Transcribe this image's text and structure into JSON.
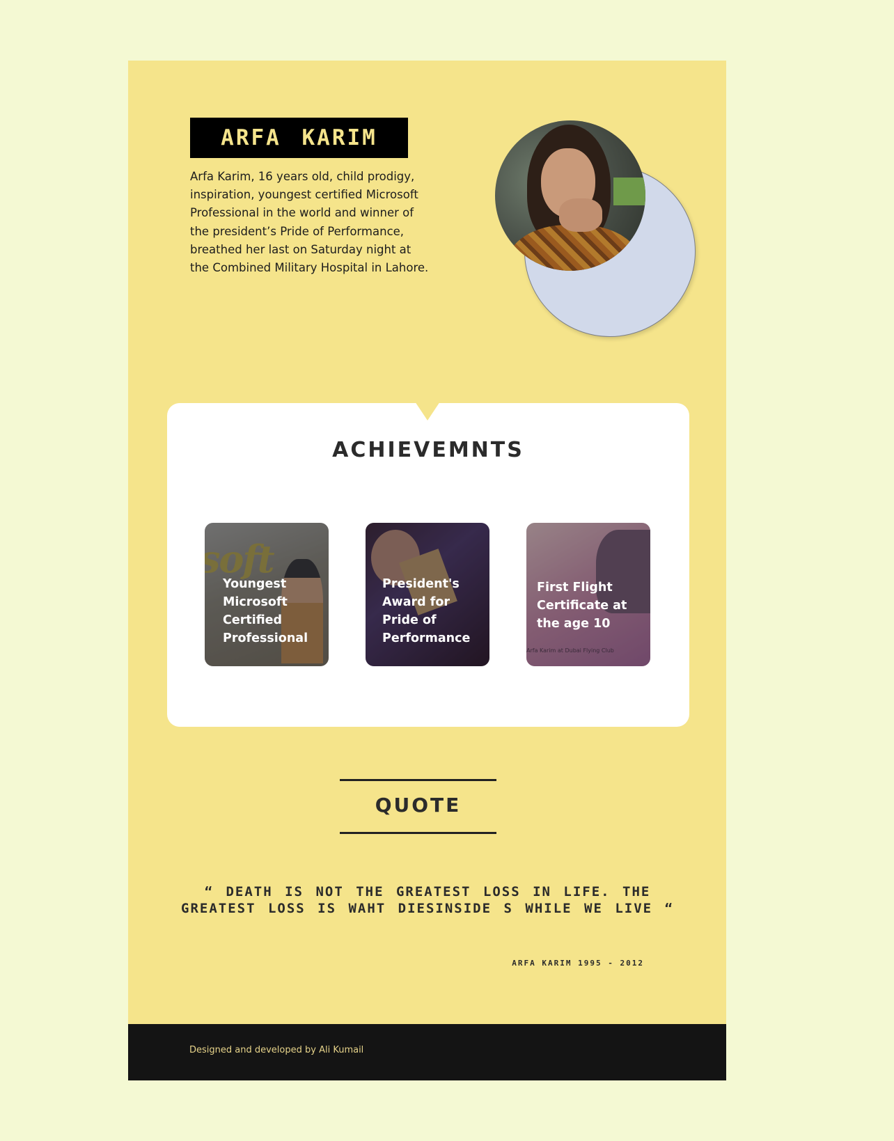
{
  "header": {
    "name": "ARFA  KARIM",
    "bio": "Arfa Karim, 16 years old, child prodigy, inspiration, youngest certified Microsoft Professional in the world and winner of the president’s Pride of Performance, breathed her last on Saturday night at the Combined Military Hospital in Lahore."
  },
  "achievements": {
    "title": "ACHIEVEMNTS",
    "items": [
      {
        "label": "Youngest Microsoft Certified Professional"
      },
      {
        "label": "President's Award for Pride of Performance"
      },
      {
        "label": "First Flight Certificate at the age 10",
        "caption": "Arfa Karim at Dubai Flying Club"
      }
    ],
    "tile1_logo_text": "soft"
  },
  "quote": {
    "heading": "QUOTE",
    "text": "“ DEATH IS NOT THE GREATEST LOSS IN LIFE. THE GREATEST LOSS IS WAHT DIESINSIDE S WHILE WE LIVE “",
    "author": "ARFA KARIM 1995 - 2012"
  },
  "footer": {
    "credit": "Designed and developed by Ali Kumail"
  },
  "colors": {
    "page_bg": "#f4f9d3",
    "panel": "#f5e48b",
    "accent_circle": "#d1d9ea",
    "footer_bg": "#141414"
  }
}
